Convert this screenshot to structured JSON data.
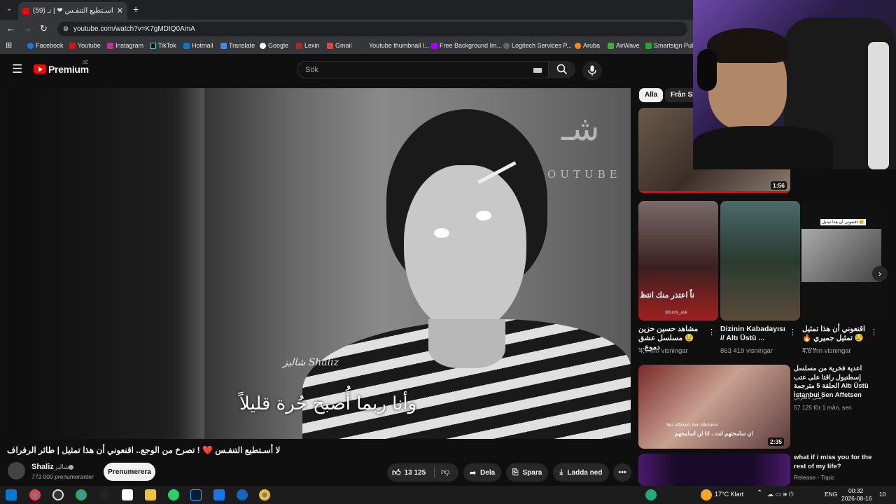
{
  "browser": {
    "tab_title": "(59) لا أسـتطيع التنفـس ❤ | نـ",
    "new_tab": "+",
    "url": "youtube.com/watch?v=K7gMDIQ0AmA",
    "bookmarks": [
      "Facebook",
      "Youtube",
      "Instagram",
      "TikTok",
      "Hotmail",
      "Translate",
      "Google",
      "Lexin",
      "Gmail",
      "Youtube thumbnail l...",
      "Free Background Im...",
      "Logitech Services P...",
      "Aruba",
      "AirWave",
      "Smartsign Publ"
    ]
  },
  "youtube": {
    "logo": "Premium",
    "region": "SE",
    "search_placeholder": "Sök",
    "video": {
      "title": "لا أسـتطيع التنفـس ❤️ ! تصرخ من الوجع.. اقنعوني أن هذا تمثيل | طائر الرفراف",
      "watermark_arabic": "شـ",
      "watermark_brand": "OUTUBE",
      "overlay_signature": "شاليز Shaliz",
      "subtitle": "وأنا ربما أُصبح حُرة قليلاً"
    },
    "channel": {
      "name": "Shaliz",
      "name_arabic": "شاليز",
      "subscribers": "773 000 prenumeranter",
      "subscribe_label": "Prenumerera"
    },
    "actions": {
      "likes": "13 125",
      "share": "Dela",
      "save": "Spara",
      "download": "Ladda ned"
    },
    "chips": [
      "Alla",
      "Från Sh"
    ],
    "featured_duration": "1:56",
    "shorts": [
      {
        "title": "مشاهد حسين حزين 😢 مسلسل عشق دموع...",
        "views": "4,7 mn visningar",
        "caption": "ناً اعتذر منك انتظ",
        "credit": "@turck_ask"
      },
      {
        "title": "Dizinin Kabadayısı // Altı Üstü ...",
        "views": "863 419 visningar"
      },
      {
        "title": "اقنعوني أن هذا تمثيل 😢 تمثيل جميري 🔥 .......",
        "views": "4,6 mn visningar",
        "caption": "اقنعوني أن هذا تمثيل 😢"
      }
    ],
    "recommended": [
      {
        "title": "اعدية فخرية من مسلسل إسطنبول راقتا على عتب الحلقة 5 مترجمة Altı Üstü İstanbul Sen Affetsen",
        "channel": "أمني بالعربي",
        "meta": "57 125 för 1 mån. sen",
        "duration": "2:35",
        "caption": "ان سامحتهم انت ، انا لن اسامحهم",
        "caption_en": "Sen affetsen, ben affetmem"
      },
      {
        "title": "what if i miss you for the rest of my life?",
        "channel": "Release - Topic"
      }
    ]
  },
  "taskbar": {
    "weather": "17°C Klart",
    "lang": "ENG",
    "time": "00:32",
    "date": "2026-08-16",
    "notifications": "10"
  }
}
